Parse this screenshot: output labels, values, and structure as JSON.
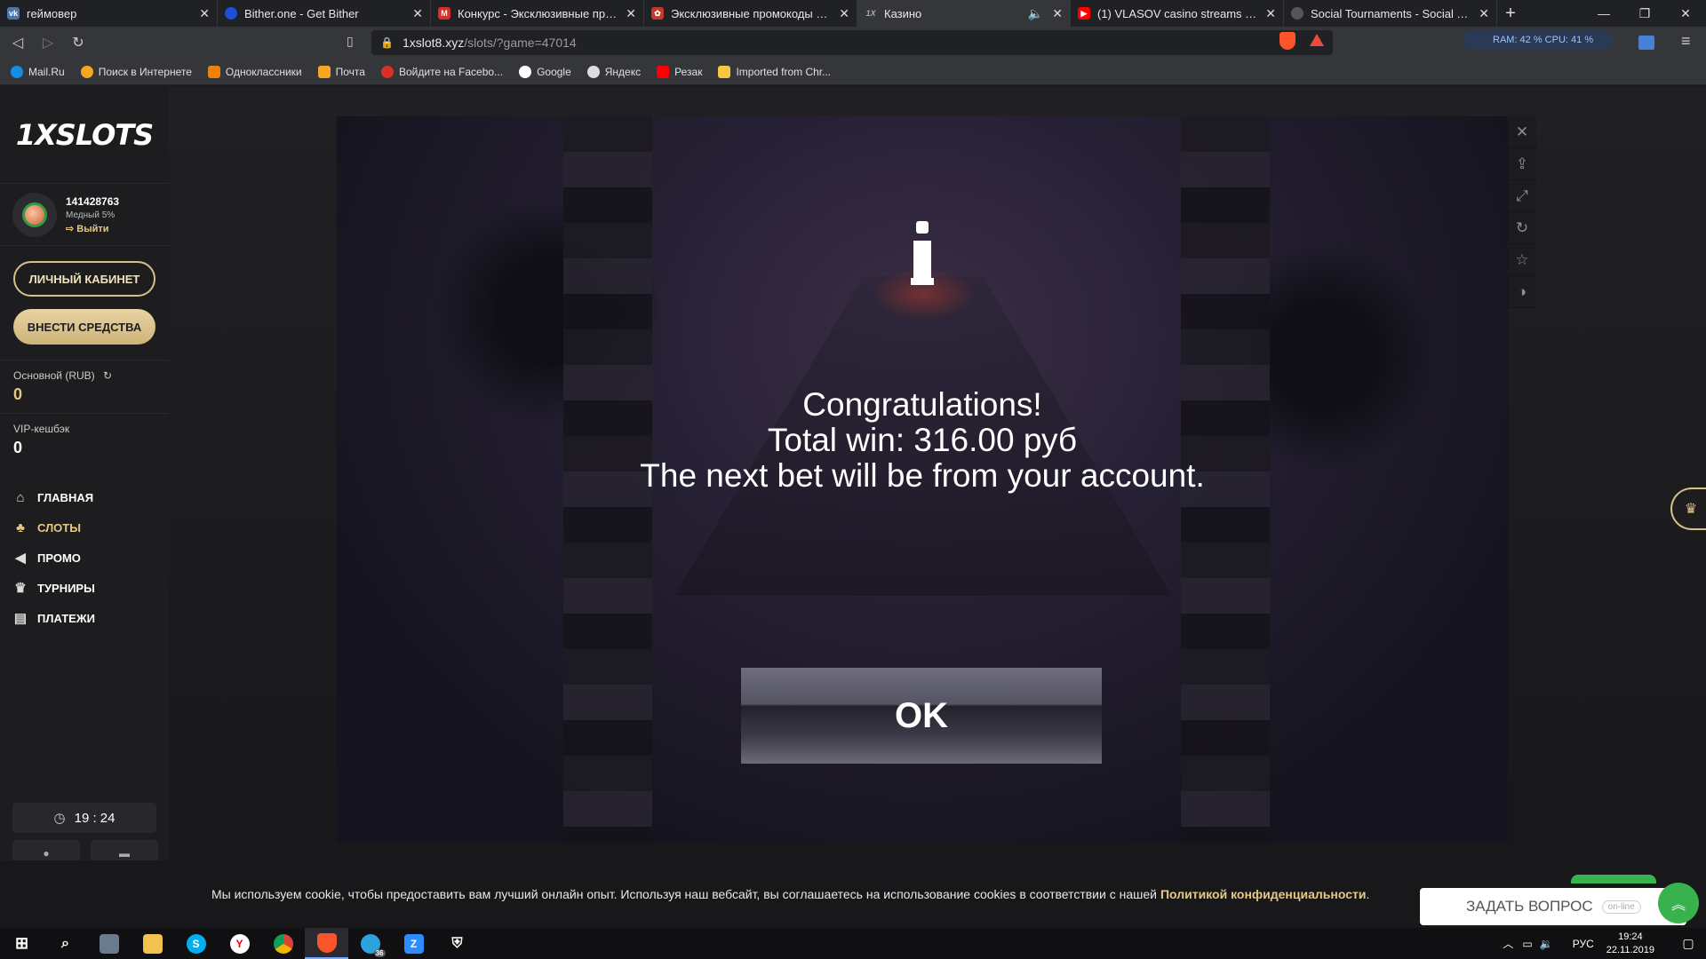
{
  "tabs": [
    {
      "title": "геймовер",
      "color": "#4a76a8",
      "glyph": "vk"
    },
    {
      "title": "Bither.one - Get Bither",
      "color": "#1f4fd8",
      "glyph": ""
    },
    {
      "title": "Конкурс - Эксклюзивные промок",
      "color": "#d93025",
      "glyph": "M"
    },
    {
      "title": "Эксклюзивные промокоды на фр",
      "color": "#c0392b",
      "glyph": "✿"
    },
    {
      "title": "Казино",
      "color": "#555",
      "glyph": "1X"
    },
    {
      "title": "(1) VLASOV casino streams - YouTu",
      "color": "#ff0000",
      "glyph": "▶"
    },
    {
      "title": "Social Tournaments - Social Tourna",
      "color": "#666",
      "glyph": "○"
    }
  ],
  "address": {
    "host": "1xslot8.xyz",
    "path": "/slots/?game=47014"
  },
  "sysmon": "RAM: 42 %  CPU: 41 %",
  "bookmarks": [
    {
      "label": "Mail.Ru",
      "color": "#168de2"
    },
    {
      "label": "Поиск в Интернете",
      "color": "#f5a623"
    },
    {
      "label": "Одноклассники",
      "color": "#ee8208"
    },
    {
      "label": "Почта",
      "color": "#f5a623"
    },
    {
      "label": "Войдите на Facebo...",
      "color": "#d93025"
    },
    {
      "label": "Google",
      "color": "#ffffff"
    },
    {
      "label": "Яндекс",
      "color": "#dddddd"
    },
    {
      "label": "Резак",
      "color": "#ff0000"
    },
    {
      "label": "Imported from Chr...",
      "color": "#f5c842"
    }
  ],
  "sidebar": {
    "logo": "1XSLOTS",
    "user_id": "141428763",
    "level": "Медный 5%",
    "logout": "⇨ Выйти",
    "cabinet_btn": "ЛИЧНЫЙ КАБИНЕТ",
    "deposit_btn": "ВНЕСТИ СРЕДСТВА",
    "main_balance_label": "Основной (RUB)",
    "main_balance_value": "0",
    "vip_label": "VIP-кешбэк",
    "vip_value": "0",
    "menu": [
      {
        "label": "ГЛАВНАЯ",
        "icon": "home-icon",
        "glyph": "⌂"
      },
      {
        "label": "СЛОТЫ",
        "icon": "cherries-icon",
        "glyph": "♣"
      },
      {
        "label": "ПРОМО",
        "icon": "megaphone-icon",
        "glyph": "◀"
      },
      {
        "label": "ТУРНИРЫ",
        "icon": "trophy-icon",
        "glyph": "♛"
      },
      {
        "label": "ПЛАТЕЖИ",
        "icon": "wallet-icon",
        "glyph": "▤"
      }
    ],
    "clock": "19 : 24"
  },
  "game": {
    "line1": "Congratulations!",
    "line2": "Total win: 316.00 руб",
    "line3": "The next bet will be from your account.",
    "ok": "OK"
  },
  "cookie": {
    "text": "Мы используем cookie, чтобы предоставить вам лучший онлайн опыт. Используя наш вебсайт, вы соглашаетесь на использование cookies в соответствии с нашей",
    "link": "Политикой конфиденциальности",
    "suffix": "."
  },
  "chat": {
    "label": "ЗАДАТЬ ВОПРОС",
    "status": "on-line"
  },
  "taskbar": {
    "lang": "РУС",
    "time": "19:24",
    "date": "22.11.2019",
    "badge": "36"
  }
}
